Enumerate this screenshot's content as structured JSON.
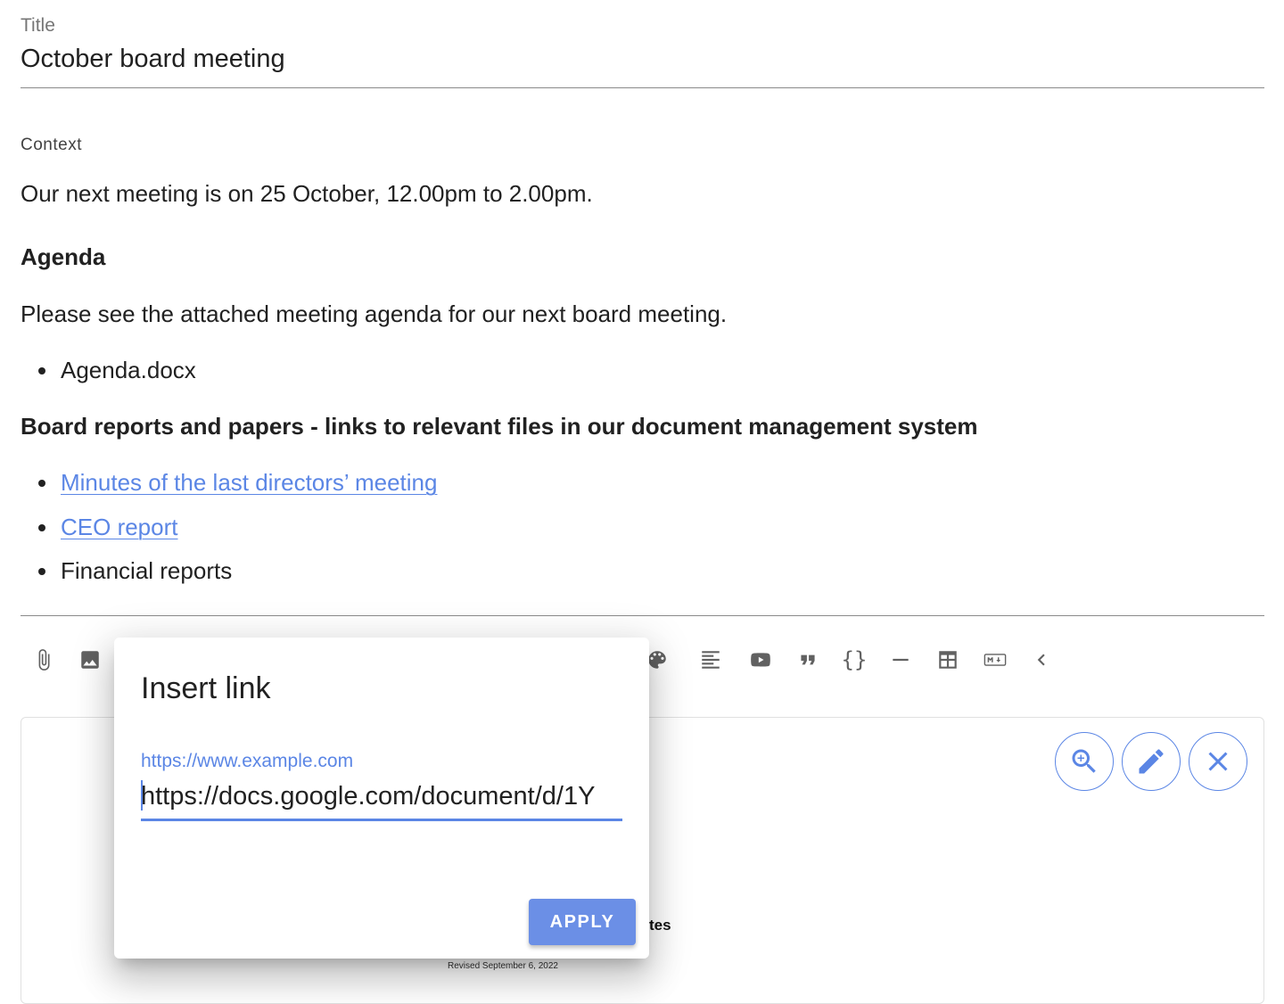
{
  "form": {
    "title_label": "Title",
    "title_value": "October board meeting",
    "context_label": "Context"
  },
  "content": {
    "intro": "Our next meeting is on 25 October, 12.00pm to 2.00pm.",
    "agenda_heading": "Agenda",
    "agenda_text": "Please see the attached meeting agenda for our next board meeting.",
    "agenda_items": [
      "Agenda.docx"
    ],
    "reports_heading": "Board reports and papers - links to relevant files in our document management system",
    "report_links": [
      "Minutes of the last directors’ meeting",
      "CEO report"
    ],
    "report_plain": "Financial reports"
  },
  "toolbar": {
    "icons": [
      "attach-icon",
      "image-icon",
      "palette-icon",
      "align-icon",
      "youtube-icon",
      "quote-icon",
      "code-braces-icon",
      "horizontal-rule-icon",
      "table-icon",
      "markdown-icon",
      "chevron-left-icon"
    ],
    "braces": "{}"
  },
  "preview": {
    "text_fragment": "tes",
    "revised": "Revised September 6, 2022",
    "action_icons": [
      "zoom-in-icon",
      "edit-icon",
      "close-icon"
    ]
  },
  "dialog": {
    "title": "Insert link",
    "placeholder": "https://www.example.com",
    "value": "https://docs.google.com/document/d/1Y",
    "apply_label": "APPLY"
  },
  "colors": {
    "accent": "#5b86e5",
    "button": "#6b8fe6",
    "text": "#212121",
    "muted": "#757575"
  }
}
